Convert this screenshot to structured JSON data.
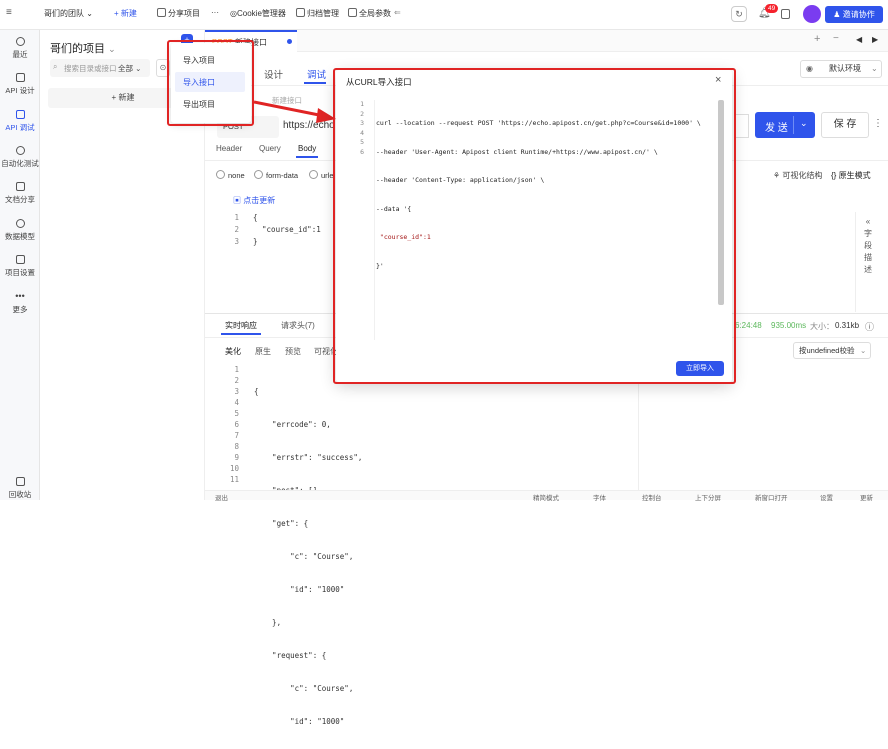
{
  "topbar": {
    "team": "哥们的团队",
    "new_label": "+ 新建",
    "share_label": "分享项目",
    "more": "···",
    "cookie_label": "Cookie管理器",
    "archive_label": "归档管理",
    "params_label": "全局参数",
    "notif_count": "49",
    "invite_label": "邀请协作"
  },
  "nav": {
    "items": [
      {
        "label": "最近"
      },
      {
        "label": "API 设计"
      },
      {
        "label": "API 调试"
      },
      {
        "label": "自动化测试"
      },
      {
        "label": "文档分享"
      },
      {
        "label": "数据模型"
      },
      {
        "label": "项目设置"
      },
      {
        "label": "更多"
      }
    ],
    "recycle": "回收站"
  },
  "project": {
    "title": "哥们的项目",
    "search_placeholder": "搜索目录或接口",
    "filter": "全部",
    "new_label": "+ 新建"
  },
  "import_menu": {
    "items": [
      "导入项目",
      "导入接口",
      "导出项目"
    ]
  },
  "tab": {
    "method": "POST",
    "name": "新建接口"
  },
  "design_tabs": {
    "design": "设计",
    "debug": "调试"
  },
  "env": "默认环境",
  "request": {
    "name_placeholder": "新建接口",
    "method": "POST",
    "url": "https://echo",
    "send": "发 送",
    "save": "保 存",
    "tabs": [
      "Header",
      "Query",
      "Body"
    ],
    "body_types": [
      "none",
      "form-data",
      "urle"
    ],
    "visual": "可视化结构",
    "raw": "原生模式",
    "update": "点击更新",
    "body_lines": [
      "{",
      "  \"course_id\":1",
      "}"
    ]
  },
  "side_labels": [
    "«",
    "字",
    "段",
    "描",
    "述"
  ],
  "response": {
    "tabs": [
      "实时响应",
      "请求头(7)"
    ],
    "subtabs": [
      "美化",
      "原生",
      "预览",
      "可视化"
    ],
    "time": "6:24:48",
    "duration": "935.00ms",
    "size_label": "大小：",
    "size": "0.31kb",
    "check": "按undefined校验",
    "lines": [
      "{",
      "    \"errcode\": 0,",
      "    \"errstr\": \"success\",",
      "    \"post\": [],",
      "    \"get\": {",
      "        \"c\": \"Course\",",
      "        \"id\": \"1000\"",
      "    },",
      "    \"request\": {",
      "        \"c\": \"Course\",",
      "        \"id\": \"1000\""
    ]
  },
  "bottombar": [
    "退出",
    "精简模式",
    "字体",
    "控制台",
    "上下分屏",
    "新窗口打开",
    "设置",
    "更新"
  ],
  "modal": {
    "title": "从CURL导入接口",
    "close": "×",
    "code_lines": [
      "curl --location --request POST 'https://echo.apipost.cn/get.php?c=Course&id=1000' \\",
      "--header 'User-Agent: Apipost client Runtime/+https://www.apipost.cn/' \\",
      "--header 'Content-Type: application/json' \\",
      "--data '{",
      " \"course_id\":1",
      "}'"
    ],
    "import_button": "立即导入"
  }
}
